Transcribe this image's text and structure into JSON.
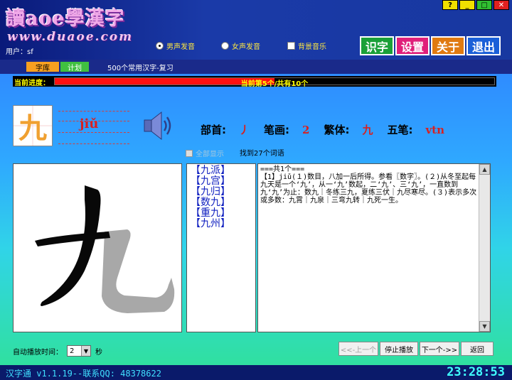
{
  "header": {
    "logo_title": "讀aoe學漢字",
    "logo_url": "www.duaoe.com",
    "user_label": "用户：sf",
    "radios": [
      {
        "label": "男声发音",
        "selected": true
      },
      {
        "label": "女声发音",
        "selected": false
      }
    ],
    "bg_music_label": "背景音乐",
    "buttons": [
      "识字",
      "设置",
      "关于",
      "退出"
    ],
    "button_colors": [
      "#1aa038",
      "#e0207a",
      "#e07a10",
      "#1a60d8"
    ]
  },
  "tabs": {
    "tab1": "字库",
    "tab2": "计划",
    "subtitle": "500个常用汉字-复习"
  },
  "progress": {
    "label": "当前进度：",
    "text": "当前第5个/共有10个",
    "fraction": 0.5
  },
  "character": {
    "char": "九",
    "pinyin": "jiǔ",
    "radical_label": "部首:",
    "radical": "丿",
    "strokes_label": "笔画:",
    "strokes": "2",
    "traditional_label": "繁体:",
    "traditional": "九",
    "wubi_label": "五笔:",
    "wubi": "vtn"
  },
  "show_all_label": "全部显示",
  "found_text": "找到27个词语",
  "words": [
    "【九派】",
    "【九宫】",
    "【九归】",
    "【数九】",
    "【重九】",
    "【九州】"
  ],
  "definition": "===共1个===\n【1】jiǔ(１)数目，八加一后所得。参看〖数字〗。(２)从冬至起每九天是一个‘九’，从一‘九’数起，二‘九’、三‘九’，一直数到九‘九’为止：数九｜冬练三九，夏练三伏｜九尽寒尽。(３)表示多次或多数：九霄｜九泉｜三弯九转｜九死一生。",
  "auto_play": {
    "label": "自动播放时间：",
    "value": "2",
    "unit": "秒"
  },
  "nav": {
    "prev": "<<-上一个",
    "stop": "停止播放",
    "next": "下一个->>",
    "back": "返回"
  },
  "status": {
    "left": "汉字通 v1.1.19--联系QQ: 48378622",
    "time": "23:28:53"
  }
}
